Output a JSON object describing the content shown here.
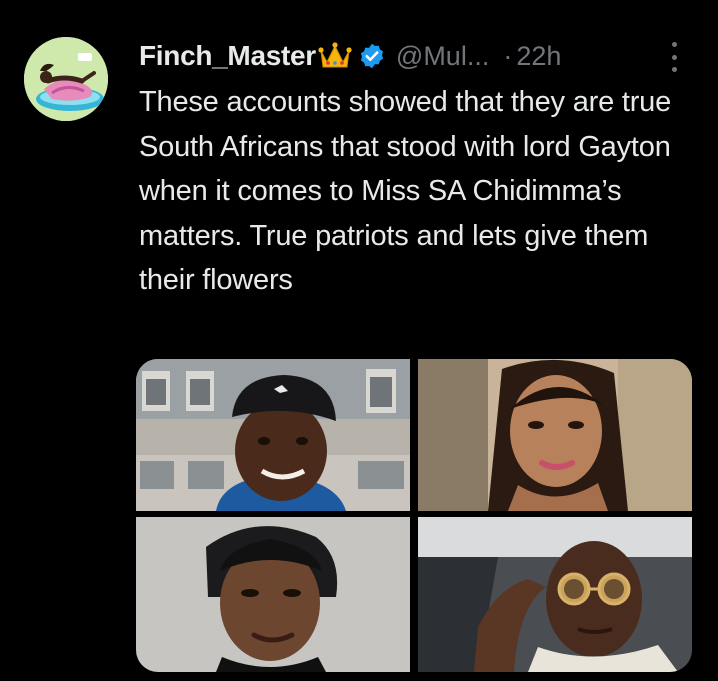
{
  "tweet": {
    "author_name": "Finch_Master",
    "handle": "@Mul...",
    "separator": "·",
    "time": "22h",
    "text": "These accounts showed that they are true South Africans that stood with lord Gayton when it comes to Miss SA Chidimma’s matters. True patriots and lets give them their flowers",
    "icons": {
      "crown": "crown-emoji-icon",
      "verified": "verified-badge-icon",
      "more": "more-options-icon"
    },
    "colors": {
      "background": "#000000",
      "text": "#e7e9ea",
      "muted": "#71767b",
      "verified": "#1d9bf0",
      "crown": "#f5b50a"
    }
  }
}
